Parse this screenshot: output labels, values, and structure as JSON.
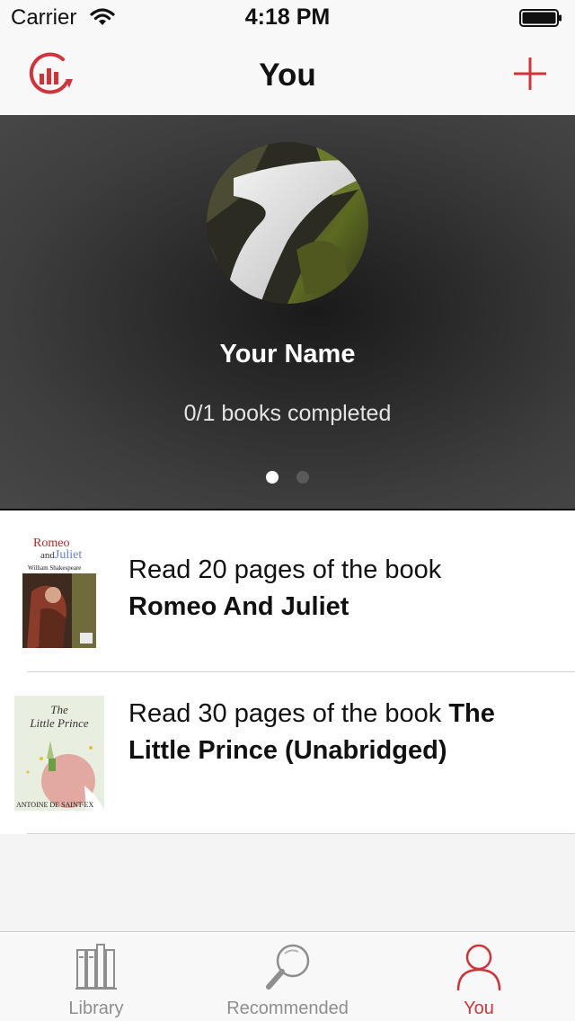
{
  "status_bar": {
    "carrier": "Carrier",
    "time": "4:18 PM"
  },
  "nav": {
    "title": "You",
    "logo_icon": "chart-refresh-icon",
    "add_icon": "plus-icon"
  },
  "profile": {
    "name": "Your Name",
    "progress": "0/1 books completed",
    "avatar_icon": "waterfall-photo",
    "page_indicator": {
      "pages": 2,
      "current": 1
    }
  },
  "goals": [
    {
      "prefix": "Read 20 pages of the book",
      "book_title": "Romeo And Juliet",
      "cover": {
        "title_line1": "Romeo",
        "title_line2": "and",
        "title_line3": "Juliet",
        "author": "William Shakespeare"
      }
    },
    {
      "prefix": "Read 30 pages of the book",
      "book_title": "The Little Prince (Unabridged)",
      "cover": {
        "title_line1": "The",
        "title_line2": "Little Prince",
        "author": "ANTOINE DE SAINT-EX"
      }
    }
  ],
  "tabs": [
    {
      "label": "Library",
      "icon": "books-icon",
      "active": false
    },
    {
      "label": "Recommended",
      "icon": "magnifier-icon",
      "active": false
    },
    {
      "label": "You",
      "icon": "person-icon",
      "active": true
    }
  ],
  "colors": {
    "accent": "#d0343a",
    "inactive_tab": "#8e8e8e"
  }
}
